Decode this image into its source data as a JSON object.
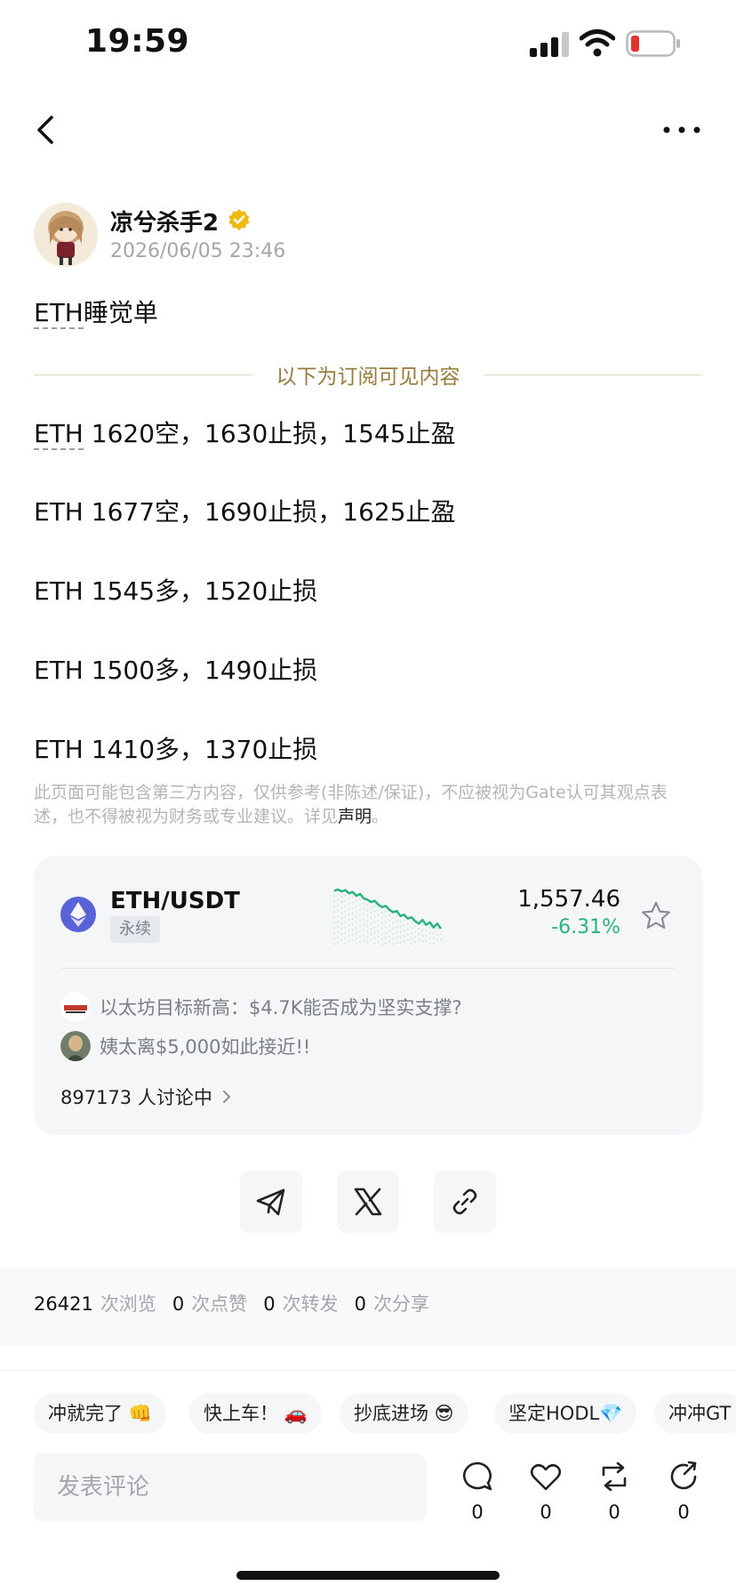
{
  "status": {
    "time": "19:59"
  },
  "post": {
    "author": "凉兮杀手2",
    "time": "2026/06/05 23:46",
    "title_link": "ETH",
    "title_rest": "睡觉单"
  },
  "subscription_label": "以下为订阅可见内容",
  "trades": [
    "ETH 1620空，1630止损，1545止盈",
    "ETH 1677空，1690止损，1625止盈",
    "ETH 1545多，1520止损",
    "ETH 1500多，1490止损",
    "ETH 1410多，1370止损"
  ],
  "first_trade_link": "ETH",
  "first_trade_rest": " 1620空，1630止损，1545止盈",
  "disclaimer": {
    "text": "此页面可能包含第三方内容，仅供参考(非陈述/保证)，不应被视为Gate认可其观点表述，也不得被视为财务或专业建议。详见",
    "link": "声明",
    "end": "。"
  },
  "market": {
    "pair": "ETH/USDT",
    "badge": "永续",
    "price": "1,557.46",
    "change": "-6.31%",
    "change_color": "#2ab37a",
    "spark": [
      1618,
      1620,
      1617,
      1619,
      1614,
      1616,
      1610,
      1613,
      1606,
      1604,
      1600,
      1602,
      1596,
      1592,
      1594,
      1588,
      1584,
      1586,
      1578,
      1580,
      1574,
      1576,
      1570,
      1566,
      1572,
      1564,
      1568,
      1560,
      1566,
      1558
    ],
    "news": [
      {
        "text": "以太坊目标新高：$4.7K能否成为坚实支撑?",
        "thumb": "news-logo"
      },
      {
        "text": "姨太离$5,000如此接近!!",
        "thumb": "news-avatar"
      }
    ],
    "discussing": "897173 人讨论中"
  },
  "stats": [
    {
      "num": "26421",
      "label": "次浏览"
    },
    {
      "num": "0",
      "label": "次点赞"
    },
    {
      "num": "0",
      "label": "次转发"
    },
    {
      "num": "0",
      "label": "次分享"
    }
  ],
  "quick_replies": [
    "冲就完了 👊",
    "快上车！ 🚗",
    "抄底进场 😎",
    "坚定HODL💎",
    "冲冲GT"
  ],
  "comment_placeholder": "发表评论",
  "actions": [
    {
      "icon": "comment-icon",
      "count": "0"
    },
    {
      "icon": "like-icon",
      "count": "0"
    },
    {
      "icon": "repost-icon",
      "count": "0"
    },
    {
      "icon": "share-icon",
      "count": "0"
    }
  ]
}
